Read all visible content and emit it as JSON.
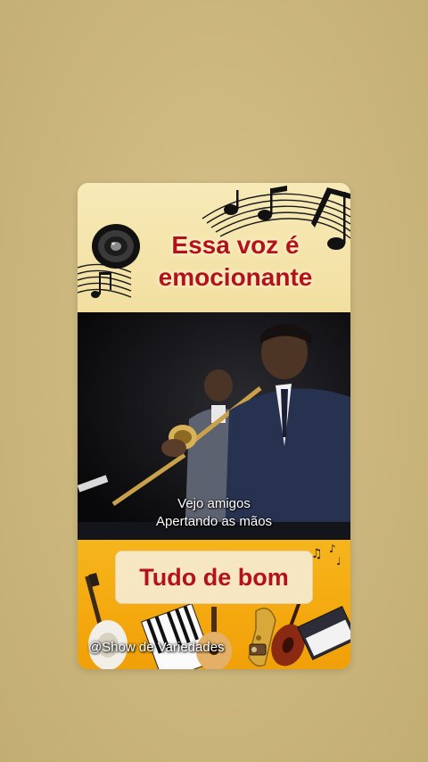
{
  "card": {
    "headline_line1": "Essa voz é",
    "headline_line2": "emocionante",
    "subtitle_line1": "Vejo amigos",
    "subtitle_line2": "Apertando as mãos",
    "tag": "Tudo de bom",
    "watermark": "@Show de Variedades"
  },
  "colors": {
    "background": "#cdb87f",
    "headline": "#b3121b",
    "bottom_banner": "#f4a80e"
  },
  "icons": [
    "speaker-icon",
    "music-notes-icon",
    "guitar-icon",
    "saxophone-icon",
    "piano-keys-icon",
    "violin-icon",
    "radio-icon"
  ]
}
